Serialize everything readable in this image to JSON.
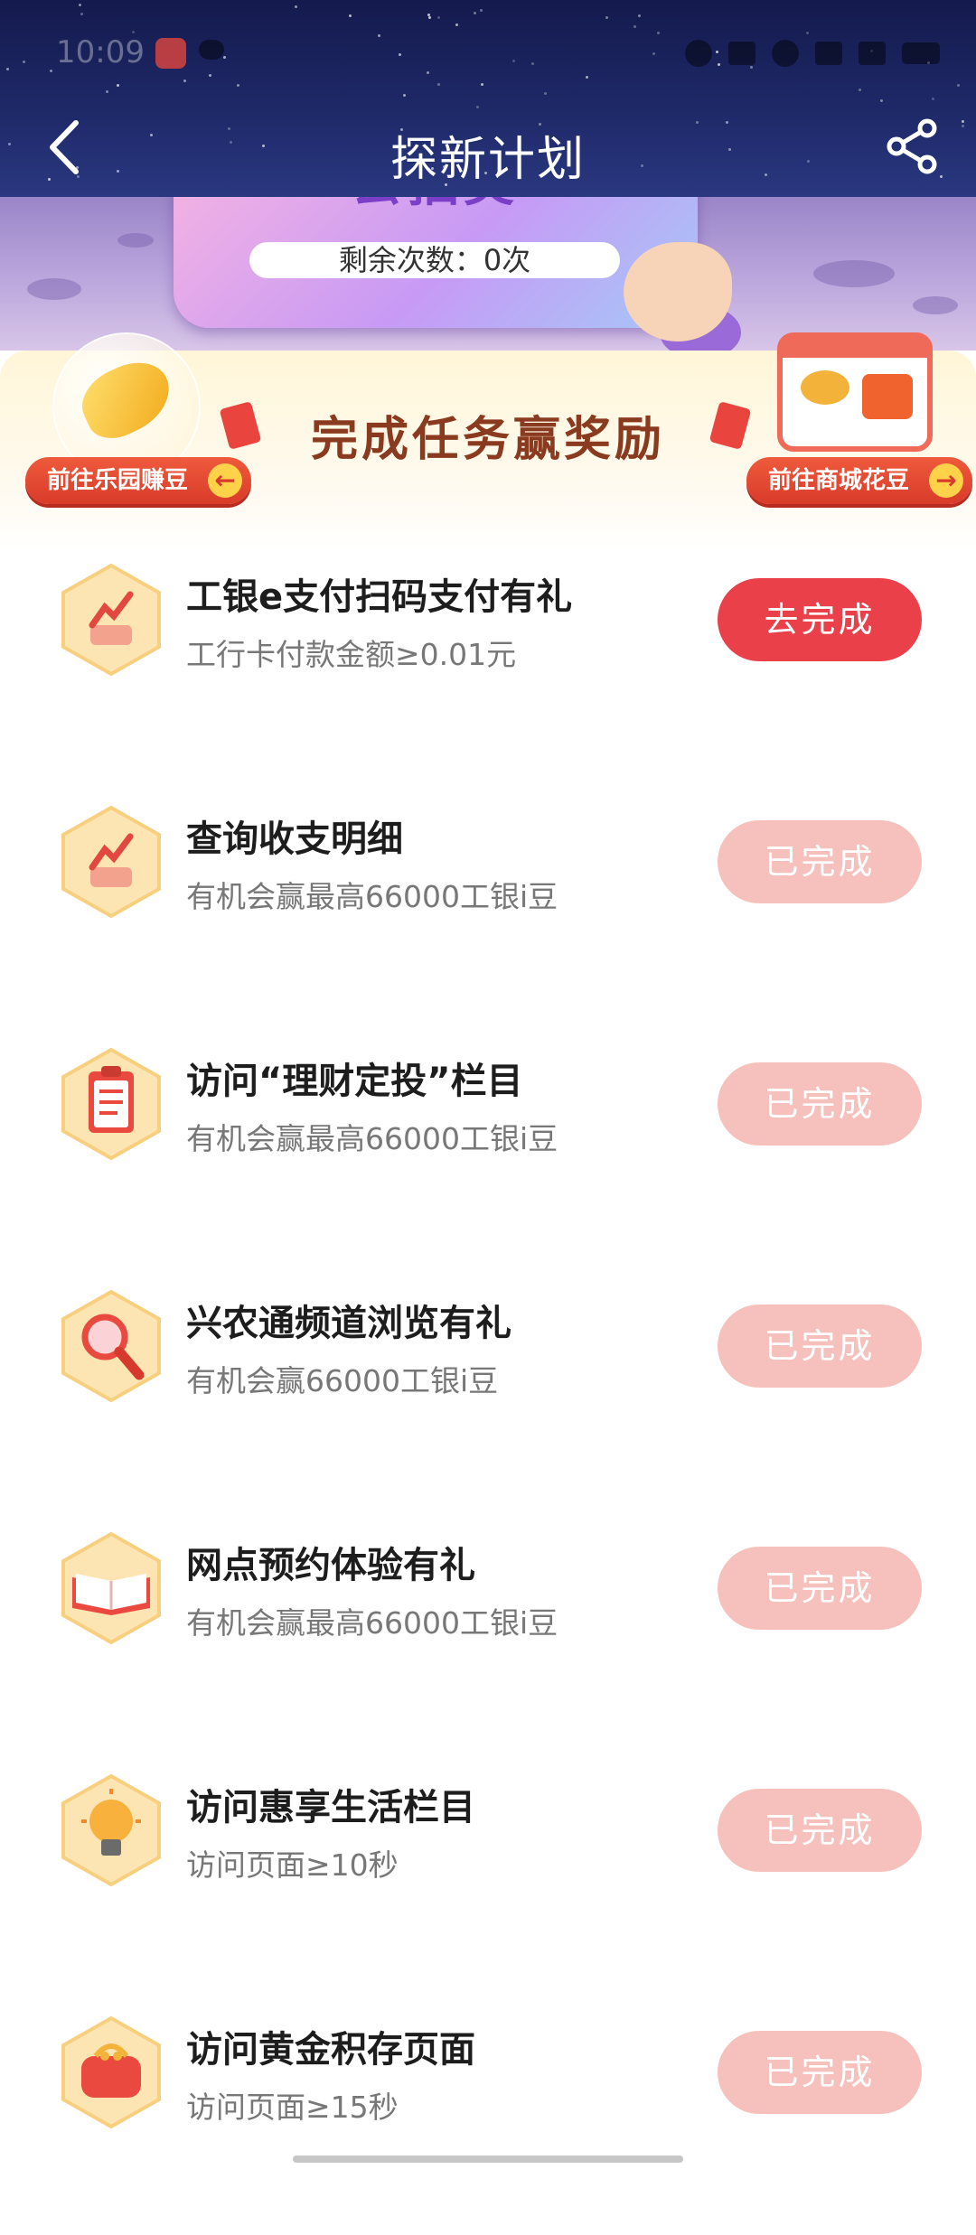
{
  "status_bar": {
    "time": "10:09"
  },
  "nav": {
    "title": "探新计划"
  },
  "lottery": {
    "title": "去抽奖",
    "remaining": "剩余次数：0次"
  },
  "reward": {
    "title": "完成任务赢奖励",
    "left_button": "前往乐园赚豆",
    "right_button": "前往商城花豆"
  },
  "tasks": [
    {
      "title": "工银e支付扫码支付有礼",
      "subtitle": "工行卡付款金额≥0.01元",
      "button": "去完成",
      "state": "active",
      "icon": "chart-trophy-icon"
    },
    {
      "title": "查询收支明细",
      "subtitle": "有机会赢最高66000工银i豆",
      "button": "已完成",
      "state": "done",
      "icon": "chart-trophy-icon"
    },
    {
      "title": "访问“理财定投”栏目",
      "subtitle": "有机会赢最高66000工银i豆",
      "button": "已完成",
      "state": "done",
      "icon": "clipboard-icon"
    },
    {
      "title": "兴农通频道浏览有礼",
      "subtitle": "有机会赢66000工银i豆",
      "button": "已完成",
      "state": "done",
      "icon": "magnifier-icon"
    },
    {
      "title": "网点预约体验有礼",
      "subtitle": "有机会赢最高66000工银i豆",
      "button": "已完成",
      "state": "done",
      "icon": "book-icon"
    },
    {
      "title": "访问惠享生活栏目",
      "subtitle": "访问页面≥10秒",
      "button": "已完成",
      "state": "done",
      "icon": "lightbulb-icon"
    },
    {
      "title": "访问黄金积存页面",
      "subtitle": "访问页面≥15秒",
      "button": "已完成",
      "state": "done",
      "icon": "purse-icon"
    }
  ],
  "colors": {
    "accent_red": "#e9404a",
    "done_pink": "#f6c0bd",
    "header_navy": "#1f2a6a",
    "reward_title_brown": "#8a3a1e"
  }
}
